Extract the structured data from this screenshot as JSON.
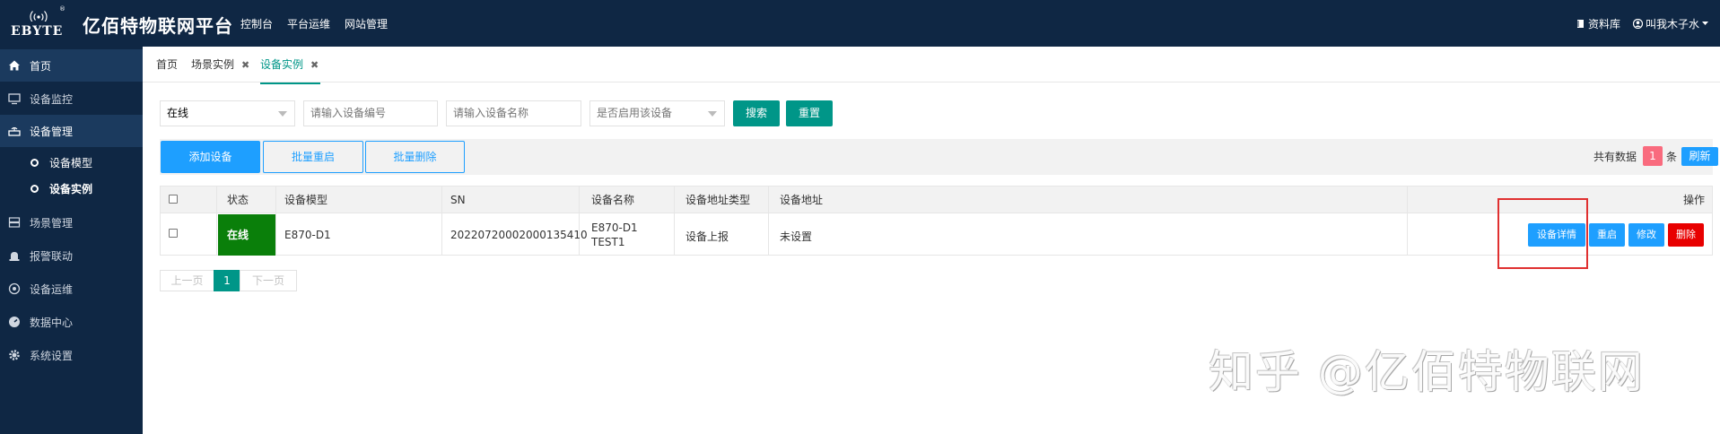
{
  "header": {
    "logo_text": "EBYTE",
    "logo_reg": "®",
    "app_title": "亿佰特物联网平台",
    "nav": [
      "控制台",
      "平台运维",
      "网站管理"
    ],
    "docs_label": "资料库",
    "user_label": "叫我木子水"
  },
  "sidebar": {
    "items": [
      {
        "label": "首页",
        "icon": "home-icon"
      },
      {
        "label": "设备监控",
        "icon": "monitor-icon"
      },
      {
        "label": "设备管理",
        "icon": "router-icon"
      },
      {
        "label": "场景管理",
        "icon": "server-icon"
      },
      {
        "label": "报警联动",
        "icon": "alarm-icon"
      },
      {
        "label": "设备运维",
        "icon": "target-icon"
      },
      {
        "label": "数据中心",
        "icon": "dashboard-icon"
      },
      {
        "label": "系统设置",
        "icon": "gear-icon"
      }
    ],
    "subitems": [
      {
        "label": "设备模型"
      },
      {
        "label": "设备实例"
      }
    ]
  },
  "tabs": [
    {
      "label": "首页"
    },
    {
      "label": "场景实例",
      "close": "✖"
    },
    {
      "label": "设备实例",
      "close": "✖"
    }
  ],
  "filters": {
    "status_value": "在线",
    "device_code_placeholder": "请输入设备编号",
    "device_name_placeholder": "请输入设备名称",
    "enabled_placeholder": "是否启用该设备",
    "search_label": "搜索",
    "reset_label": "重置"
  },
  "toolbar": {
    "add_label": "添加设备",
    "batch_restart_label": "批量重启",
    "batch_delete_label": "批量删除",
    "total_prefix": "共有数据",
    "total_count": "1",
    "total_suffix": "条",
    "refresh_label": "刷新"
  },
  "table": {
    "headers": [
      "状态",
      "设备模型",
      "SN",
      "设备名称",
      "设备地址类型",
      "设备地址",
      "操作"
    ],
    "rows": [
      {
        "status": "在线",
        "model": "E870-D1",
        "sn": "20220720002000135410",
        "name_line1": "E870-D1",
        "name_line2": "TEST1",
        "address_type": "设备上报",
        "address": "未设置",
        "actions": [
          "设备详情",
          "重启",
          "修改",
          "删除"
        ]
      }
    ]
  },
  "pagination": {
    "prev": "上一页",
    "current": "1",
    "next": "下一页"
  },
  "watermark": "知乎 @亿佰特物联网",
  "colors": {
    "navy": "#0f2744",
    "teal": "#009688",
    "blue": "#1e9fff",
    "online_green": "#0a7f0a",
    "delete_red": "#e80000"
  }
}
